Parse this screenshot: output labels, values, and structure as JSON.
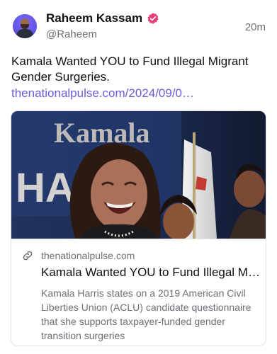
{
  "author": {
    "name": "Raheem Kassam",
    "handle": "@Raheem",
    "time": "20m",
    "verified_color": "#e5407a",
    "avatar_color": "#6a5cf0"
  },
  "post": {
    "text": "Kamala Wanted YOU to Fund Illegal Migrant Gender Surgeries.",
    "link_text": "thenationalpulse.com/2024/09/0…",
    "link_color": "#6a5cd8"
  },
  "card": {
    "image_banner_text": "Kamala",
    "image_banner_text_2": "HA",
    "domain": "thenationalpulse.com",
    "title": "Kamala Wanted YOU to Fund Illegal Migrant Gender Surgeries.",
    "description": "Kamala Harris states on a 2019 American Civil Liberties Union (ACLU) candidate questionnaire that she supports taxpayer-funded gender transition surgeries"
  },
  "icons": {
    "verified": "verified-badge-icon",
    "link": "link-chain-icon"
  }
}
